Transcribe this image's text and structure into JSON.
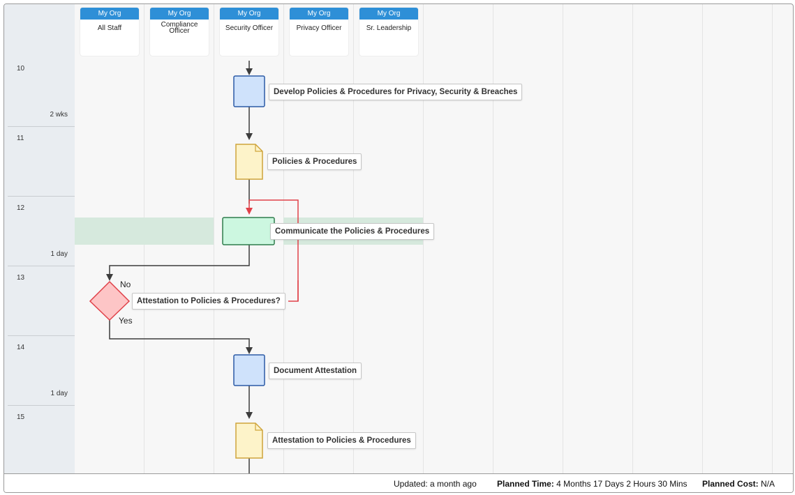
{
  "lanes": [
    {
      "org": "My Org",
      "role": "All Staff"
    },
    {
      "org": "My Org",
      "role": "Compliance Officer"
    },
    {
      "org": "My Org",
      "role": "Security Officer"
    },
    {
      "org": "My Org",
      "role": "Privacy Officer"
    },
    {
      "org": "My Org",
      "role": "Sr. Leadership"
    }
  ],
  "rows": [
    {
      "num": "10",
      "duration": "2 wks"
    },
    {
      "num": "11",
      "duration": ""
    },
    {
      "num": "12",
      "duration": "1 day"
    },
    {
      "num": "13",
      "duration": ""
    },
    {
      "num": "14",
      "duration": "1 day"
    },
    {
      "num": "15",
      "duration": ""
    }
  ],
  "steps": {
    "develop": "Develop Policies & Procedures for Privacy, Security & Breaches",
    "policies_doc": "Policies & Procedures",
    "communicate": "Communicate the Policies & Procedures",
    "decision": "Attestation to Policies & Procedures?",
    "document": "Document Attestation",
    "attestation_doc": "Attestation to Policies & Procedures"
  },
  "branches": {
    "no": "No",
    "yes": "Yes"
  },
  "footer": {
    "updated": "Updated: a month ago",
    "planned_time_label": "Planned Time:",
    "planned_time_value": "4 Months 17 Days 2 Hours 30 Mins",
    "planned_cost_label": "Planned Cost:",
    "planned_cost_value": "N/A"
  },
  "colors": {
    "lane_header": "#2e8fd7",
    "task_fill": "#cfe2fb",
    "task_stroke": "#2b5aa6",
    "doc_fill": "#fdf3c9",
    "doc_stroke": "#cfa43a",
    "comm_fill": "#ccf7e0",
    "comm_stroke": "#2f7d4c",
    "decision_fill": "#fdc5c6",
    "decision_stroke": "#e04048",
    "loop_line": "#e04048"
  }
}
